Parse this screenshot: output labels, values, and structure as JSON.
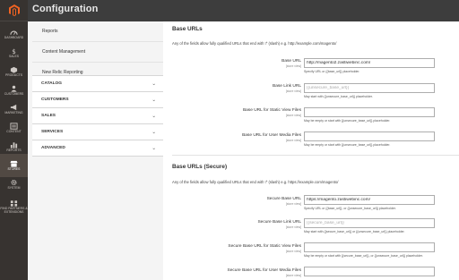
{
  "header": {
    "title": "Configuration"
  },
  "admin_nav": [
    {
      "label": "DASHBOARD",
      "icon": "dashboard-icon"
    },
    {
      "label": "SALES",
      "icon": "dollar-icon"
    },
    {
      "label": "PRODUCTS",
      "icon": "cube-icon"
    },
    {
      "label": "CUSTOMERS",
      "icon": "customers-icon"
    },
    {
      "label": "MARKETING",
      "icon": "megaphone-icon"
    },
    {
      "label": "CONTENT",
      "icon": "content-icon"
    },
    {
      "label": "REPORTS",
      "icon": "bar-chart-icon"
    },
    {
      "label": "STORES",
      "icon": "store-icon"
    },
    {
      "label": "SYSTEM",
      "icon": "gear-icon"
    },
    {
      "label": "FIND PARTNERS & EXTENSIONS",
      "icon": "extensions-icon"
    }
  ],
  "sidebar": {
    "links": [
      "Reports",
      "Content Management",
      "New Relic Reporting"
    ],
    "sections": [
      "CATALOG",
      "CUSTOMERS",
      "SALES",
      "SERVICES",
      "ADVANCED"
    ],
    "chevron": "⌄"
  },
  "base_urls": {
    "title": "Base URLs",
    "intro": "Any of the fields allow fully qualified URLs that end with '/' (slash) e.g. http://example.com/magento/",
    "fields": [
      {
        "label": "Base URL",
        "scope": "[store view]",
        "value": "http://magento2.zastiwebinc.com/",
        "note": "Specify URL or {{base_url}} placeholder."
      },
      {
        "label": "Base Link URL",
        "scope": "[store view]",
        "placeholder": "{{unsecure_base_url}}",
        "note": "May start with {{unsecure_base_url}} placeholder."
      },
      {
        "label": "Base URL for Static View Files",
        "scope": "[store view]",
        "note": "May be empty or start with {{unsecure_base_url}} placeholder."
      },
      {
        "label": "Base URL for User Media Files",
        "scope": "[store view]",
        "note": "May be empty or start with {{unsecure_base_url}} placeholder."
      }
    ]
  },
  "secure_urls": {
    "title": "Base URLs (Secure)",
    "intro": "Any of the fields allow fully qualified URLs that end with '/' (slash) e.g. https://example.com/magento/",
    "fields": [
      {
        "label": "Secure Base URL",
        "scope": "[store view]",
        "value": "https://magento.zastiwebinc.com/",
        "note": "Specify URL or {{base_url}}, or {{unsecure_base_url}} placeholder."
      },
      {
        "label": "Secure Base Link URL",
        "scope": "[store view]",
        "placeholder": "{{secure_base_url}}",
        "note": "May start with {{secure_base_url}} or {{unsecure_base_url}} placeholder."
      },
      {
        "label": "Secure Base URL for Static View Files",
        "scope": "[store view]",
        "note": "May be empty or start with {{secure_base_url}}, or {{unsecure_base_url}} placeholder."
      },
      {
        "label": "Secure Base URL for User Media Files",
        "scope": "[store view]"
      }
    ]
  }
}
